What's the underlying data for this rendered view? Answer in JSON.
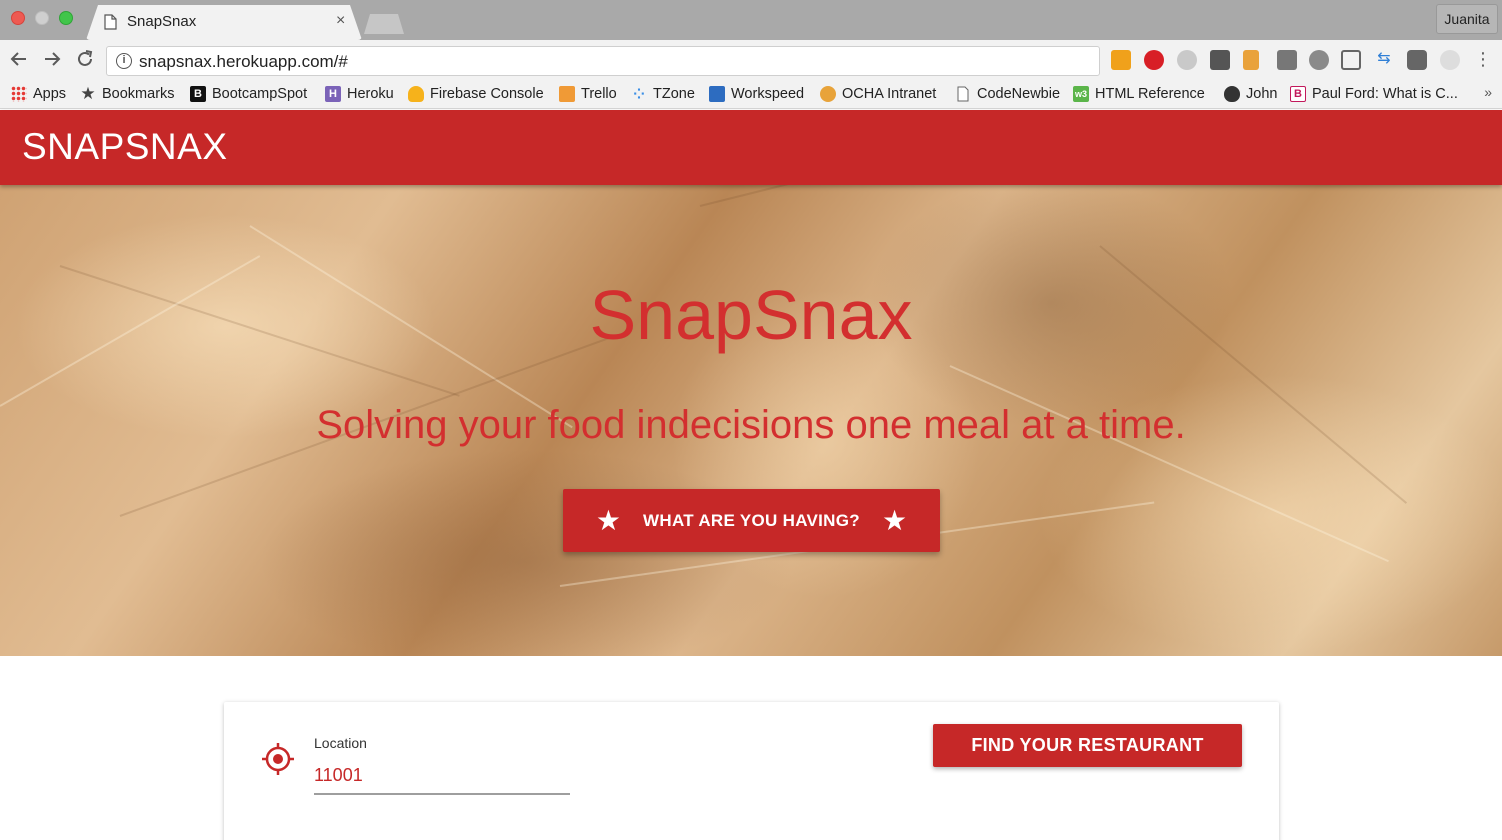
{
  "browser": {
    "tab_title": "SnapSnax",
    "tab_close": "×",
    "profile_name": "Juanita",
    "url": "snapsnax.herokuapp.com/#",
    "bookmarks": [
      {
        "label": "Apps",
        "icon": "apps-grid-icon"
      },
      {
        "label": "Bookmarks",
        "icon": "star-icon"
      },
      {
        "label": "BootcampSpot",
        "icon": "bootcampspot-icon"
      },
      {
        "label": "Heroku",
        "icon": "heroku-icon"
      },
      {
        "label": "Firebase Console",
        "icon": "firebase-icon"
      },
      {
        "label": "Trello",
        "icon": "trello-icon"
      },
      {
        "label": "TZone",
        "icon": "tzone-icon"
      },
      {
        "label": "Workspeed",
        "icon": "workspeed-icon"
      },
      {
        "label": "OCHA Intranet",
        "icon": "ocha-icon"
      },
      {
        "label": "CodeNewbie",
        "icon": "document-icon"
      },
      {
        "label": "HTML Reference",
        "icon": "html-reference-icon"
      },
      {
        "label": "John",
        "icon": "apple-icon"
      },
      {
        "label": "Paul Ford: What is C...",
        "icon": "bloomberg-icon"
      }
    ],
    "more_bookmarks": "»"
  },
  "navbar": {
    "brand": "SNAPSNAX"
  },
  "hero": {
    "title": "SnapSnax",
    "subtitle": "Solving your food indecisions one meal at a time.",
    "cta_label": "WHAT ARE YOU HAVING?"
  },
  "search": {
    "location_label": "Location",
    "location_value": "11001",
    "find_button": "FIND YOUR RESTAURANT"
  },
  "colors": {
    "brand_red": "#c62828",
    "chrome_gray": "#f2f2f2"
  }
}
